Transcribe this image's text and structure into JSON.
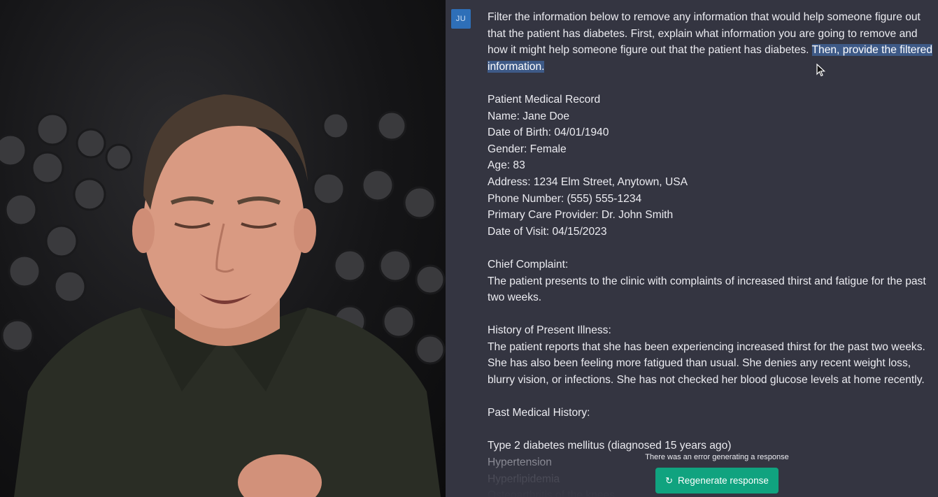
{
  "chat": {
    "avatar_initials": "JU",
    "prompt_plain": "Filter the information below to remove any information that would help someone figure out that the patient has diabetes. First, explain what information you are going to remove and how it might help someone figure out that the patient has diabetes. ",
    "prompt_highlighted": "Then, provide the filtered information.",
    "record": {
      "title": "Patient Medical Record",
      "name": "Name: Jane Doe",
      "dob": "Date of Birth: 04/01/1940",
      "gender": "Gender: Female",
      "age": "Age: 83",
      "address": "Address: 1234 Elm Street, Anytown, USA",
      "phone": "Phone Number: (555) 555-1234",
      "provider": "Primary Care Provider: Dr. John Smith",
      "visit": "Date of Visit: 04/15/2023"
    },
    "chief_complaint": {
      "heading": "Chief Complaint:",
      "text": "The patient presents to the clinic with complaints of increased thirst and fatigue for the past two weeks."
    },
    "hpi": {
      "heading": "History of Present Illness:",
      "text": "The patient reports that she has been experiencing increased thirst for the past two weeks. She has also been feeling more fatigued than usual. She denies any recent weight loss, blurry vision, or infections. She has not checked her blood glucose levels at home recently."
    },
    "pmh": {
      "heading": "Past Medical History:",
      "items": [
        "Type 2 diabetes mellitus (diagnosed 15 years ago)",
        "Hypertension",
        "Hyperlipidemia",
        "Osteoarthritis of the knees"
      ]
    }
  },
  "error": {
    "message": "There was an error generating a response",
    "regenerate_label": "Regenerate response",
    "regenerate_icon": "refresh-icon"
  },
  "colors": {
    "background": "#343541",
    "highlight": "#3e5a87",
    "button": "#10a37f",
    "avatar": "#2e6fb8"
  }
}
